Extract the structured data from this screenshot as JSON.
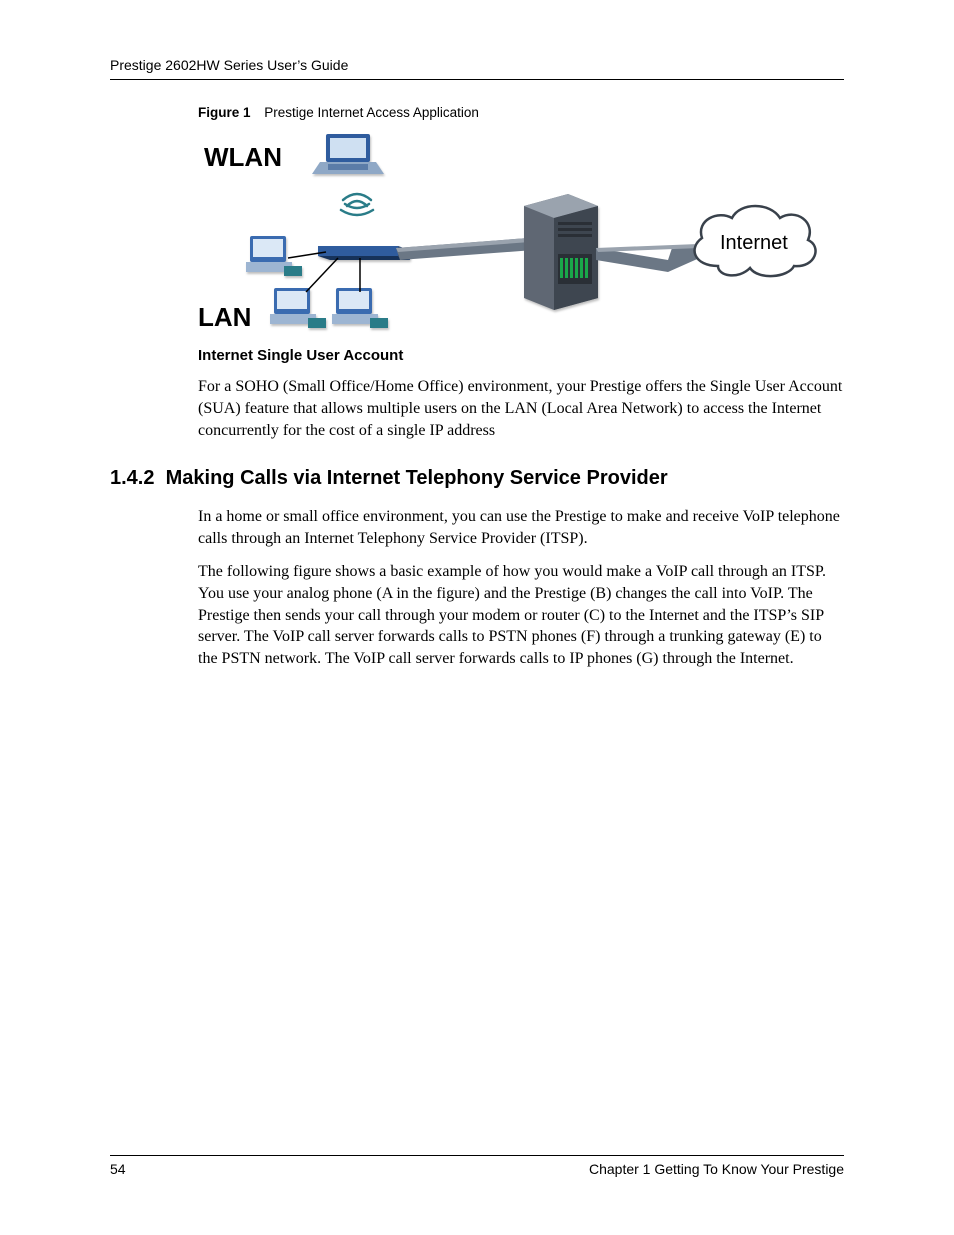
{
  "header": {
    "running_title": "Prestige 2602HW Series User’s Guide"
  },
  "footer": {
    "page_number": "54",
    "chapter": "Chapter 1 Getting To Know Your Prestige"
  },
  "figure1": {
    "label": "Figure 1",
    "caption": "Prestige Internet Access Application",
    "labels": {
      "wlan": "WLAN",
      "lan": "LAN",
      "internet": "Internet"
    }
  },
  "subsection": {
    "title": "Internet Single User Account",
    "para": "For a SOHO (Small Office/Home Office) environment, your Prestige offers the Single User Account (SUA) feature that allows multiple users on the LAN (Local Area Network) to access the Internet concurrently for the cost of a single IP address"
  },
  "section_142": {
    "number": "1.4.2",
    "title": "Making Calls via Internet Telephony Service Provider",
    "para1": "In a home or small office environment, you can use the Prestige to make and receive VoIP telephone calls through an Internet Telephony Service Provider (ITSP).",
    "para2": "The following figure shows a basic example of how you would make a VoIP call through an ITSP. You use your analog phone (A in the figure) and the Prestige (B) changes the call into VoIP. The Prestige then sends your call through your modem or router (C) to the Internet and the ITSP’s SIP server. The VoIP call server forwards calls to PSTN phones (F) through a trunking gateway (E) to the PSTN network. The VoIP call server forwards calls to IP phones (G) through the Internet."
  }
}
